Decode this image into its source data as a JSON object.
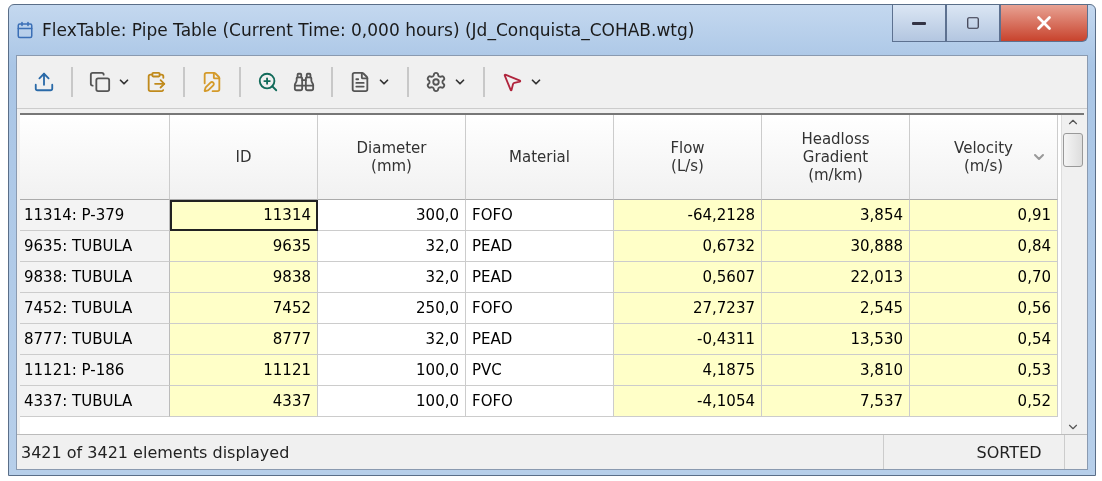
{
  "window": {
    "title": "FlexTable: Pipe Table (Current Time:  0,000 hours) (Jd_Conquista_COHAB.wtg)"
  },
  "toolbar": [
    [
      {
        "kind": "export",
        "dropdown": false
      }
    ],
    [
      {
        "kind": "copy",
        "dropdown": true
      },
      {
        "kind": "paste",
        "dropdown": false
      }
    ],
    [
      {
        "kind": "edit",
        "dropdown": false
      }
    ],
    [
      {
        "kind": "zoom",
        "dropdown": false
      },
      {
        "kind": "find",
        "dropdown": false
      }
    ],
    [
      {
        "kind": "report",
        "dropdown": true
      }
    ],
    [
      {
        "kind": "options",
        "dropdown": true
      }
    ],
    [
      {
        "kind": "select",
        "dropdown": true
      }
    ]
  ],
  "table": {
    "columns": [
      {
        "label": "ID",
        "readonly": true,
        "sorted": false,
        "kind": "number"
      },
      {
        "label": "Diameter\n(mm)",
        "readonly": false,
        "sorted": false,
        "kind": "number"
      },
      {
        "label": "Material",
        "readonly": false,
        "sorted": false,
        "kind": "text"
      },
      {
        "label": "Flow\n(L/s)",
        "readonly": true,
        "sorted": false,
        "kind": "number"
      },
      {
        "label": "Headloss\nGradient\n(m/km)",
        "readonly": true,
        "sorted": false,
        "kind": "number"
      },
      {
        "label": "Velocity\n(m/s)",
        "readonly": true,
        "sorted": true,
        "kind": "number"
      }
    ],
    "rows": [
      {
        "label": "11314: P-379",
        "focused": true,
        "cells": [
          "11314",
          "300,0",
          "FOFO",
          "-64,2128",
          "3,854",
          "0,91"
        ]
      },
      {
        "label": "9635: TUBULA",
        "focused": false,
        "cells": [
          "9635",
          "32,0",
          "PEAD",
          "0,6732",
          "30,888",
          "0,84"
        ]
      },
      {
        "label": "9838: TUBULA",
        "focused": false,
        "cells": [
          "9838",
          "32,0",
          "PEAD",
          "0,5607",
          "22,013",
          "0,70"
        ]
      },
      {
        "label": "7452: TUBULA",
        "focused": false,
        "cells": [
          "7452",
          "250,0",
          "FOFO",
          "27,7237",
          "2,545",
          "0,56"
        ]
      },
      {
        "label": "8777: TUBULA",
        "focused": false,
        "cells": [
          "8777",
          "32,0",
          "PEAD",
          "-0,4311",
          "13,530",
          "0,54"
        ]
      },
      {
        "label": "11121: P-186",
        "focused": false,
        "cells": [
          "11121",
          "100,0",
          "PVC",
          "4,1875",
          "3,810",
          "0,53"
        ]
      },
      {
        "label": "4337: TUBULA",
        "focused": false,
        "cells": [
          "4337",
          "100,0",
          "FOFO",
          "-4,1054",
          "7,537",
          "0,52"
        ]
      }
    ]
  },
  "status_bar": {
    "message": "3421 of 3421 elements displayed",
    "mode": "SORTED"
  }
}
